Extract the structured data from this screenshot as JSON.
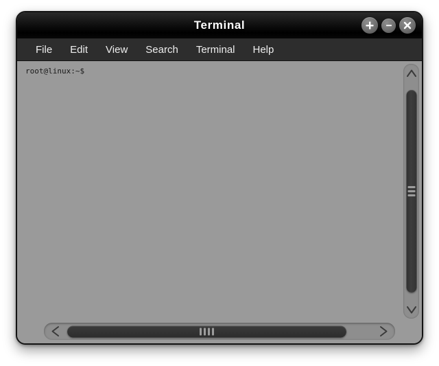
{
  "window": {
    "title": "Terminal",
    "controls": [
      {
        "name": "maximize-button",
        "icon": "plus-icon",
        "label": "+"
      },
      {
        "name": "minimize-button",
        "icon": "minus-icon",
        "label": "–"
      },
      {
        "name": "close-button",
        "icon": "close-icon",
        "label": "✕"
      }
    ]
  },
  "menubar": {
    "items": [
      {
        "label": "File"
      },
      {
        "label": "Edit"
      },
      {
        "label": "View"
      },
      {
        "label": "Search"
      },
      {
        "label": "Terminal"
      },
      {
        "label": "Help"
      }
    ]
  },
  "terminal": {
    "prompt": "root@linux:~$",
    "background_color": "#9a9a9a",
    "text_color": "#1a1a1a"
  },
  "scrollbars": {
    "vertical": {
      "up_arrow_icon": "chevron-up-icon",
      "down_arrow_icon": "chevron-down-icon",
      "grip_lines": 3
    },
    "horizontal": {
      "left_arrow_icon": "chevron-left-icon",
      "right_arrow_icon": "chevron-right-icon",
      "grip_lines": 4
    }
  }
}
